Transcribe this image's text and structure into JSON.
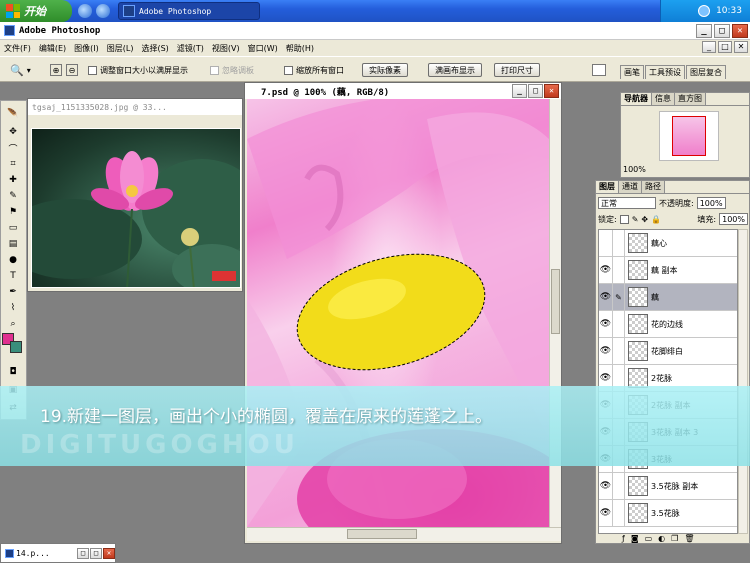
{
  "taskbar": {
    "start_label": "开始",
    "task_title": "Adobe Photoshop",
    "clock": "10:33"
  },
  "app": {
    "title": "Adobe Photoshop"
  },
  "menu": [
    "文件(F)",
    "编辑(E)",
    "图像(I)",
    "图层(L)",
    "选择(S)",
    "滤镜(T)",
    "视图(V)",
    "窗口(W)",
    "帮助(H)"
  ],
  "options": {
    "resize_window": "调整窗口大小以满屏显示",
    "ignore_palettes": "忽略调板",
    "zoom_all": "缩放所有窗口",
    "actual_pixels": "实际像素",
    "fit_screen": "满画布显示",
    "print_size": "打印尺寸",
    "palette_tabs": [
      "画笔",
      "工具预设",
      "图层复合"
    ]
  },
  "doc1": {
    "title": "tgsaj_1151335028.jpg @ 33..."
  },
  "doc2": {
    "title": "7.psd @ 100% (藕, RGB/8)"
  },
  "navigator": {
    "tabs": [
      "导航器",
      "信息",
      "直方图"
    ],
    "zoom": "100%"
  },
  "layers_panel": {
    "tabs": [
      "图层",
      "通道",
      "路径"
    ],
    "blend_mode": "正常",
    "opacity_label": "不透明度:",
    "opacity_value": "100%",
    "lock_label": "锁定:",
    "fill_label": "填充:",
    "fill_value": "100%",
    "layers": [
      {
        "name": "藕心",
        "visible": false,
        "selected": false
      },
      {
        "name": "藕 副本",
        "visible": true,
        "selected": false
      },
      {
        "name": "藕",
        "visible": true,
        "selected": true
      },
      {
        "name": "花的边线",
        "visible": true,
        "selected": false
      },
      {
        "name": "花脚绯白",
        "visible": true,
        "selected": false
      },
      {
        "name": "2花脉",
        "visible": true,
        "selected": false
      },
      {
        "name": "2花脉 副本",
        "visible": true,
        "selected": false
      },
      {
        "name": "3花脉 副本 3",
        "visible": true,
        "selected": false
      },
      {
        "name": "3花脉",
        "visible": true,
        "selected": false
      },
      {
        "name": "3.5花脉 副本",
        "visible": true,
        "selected": false
      },
      {
        "name": "3.5花脉",
        "visible": true,
        "selected": false
      }
    ]
  },
  "caption": {
    "text": "19.新建一图层，画出个小的椭圆，覆盖在原来的莲蓬之上。",
    "watermark": "DIGITUGOGHOU"
  },
  "minimized": {
    "title": "14.p..."
  },
  "colors": {
    "foreground": "#e0308f",
    "background": "#3a8f7c",
    "selection_fill": "#f2dc1a"
  }
}
